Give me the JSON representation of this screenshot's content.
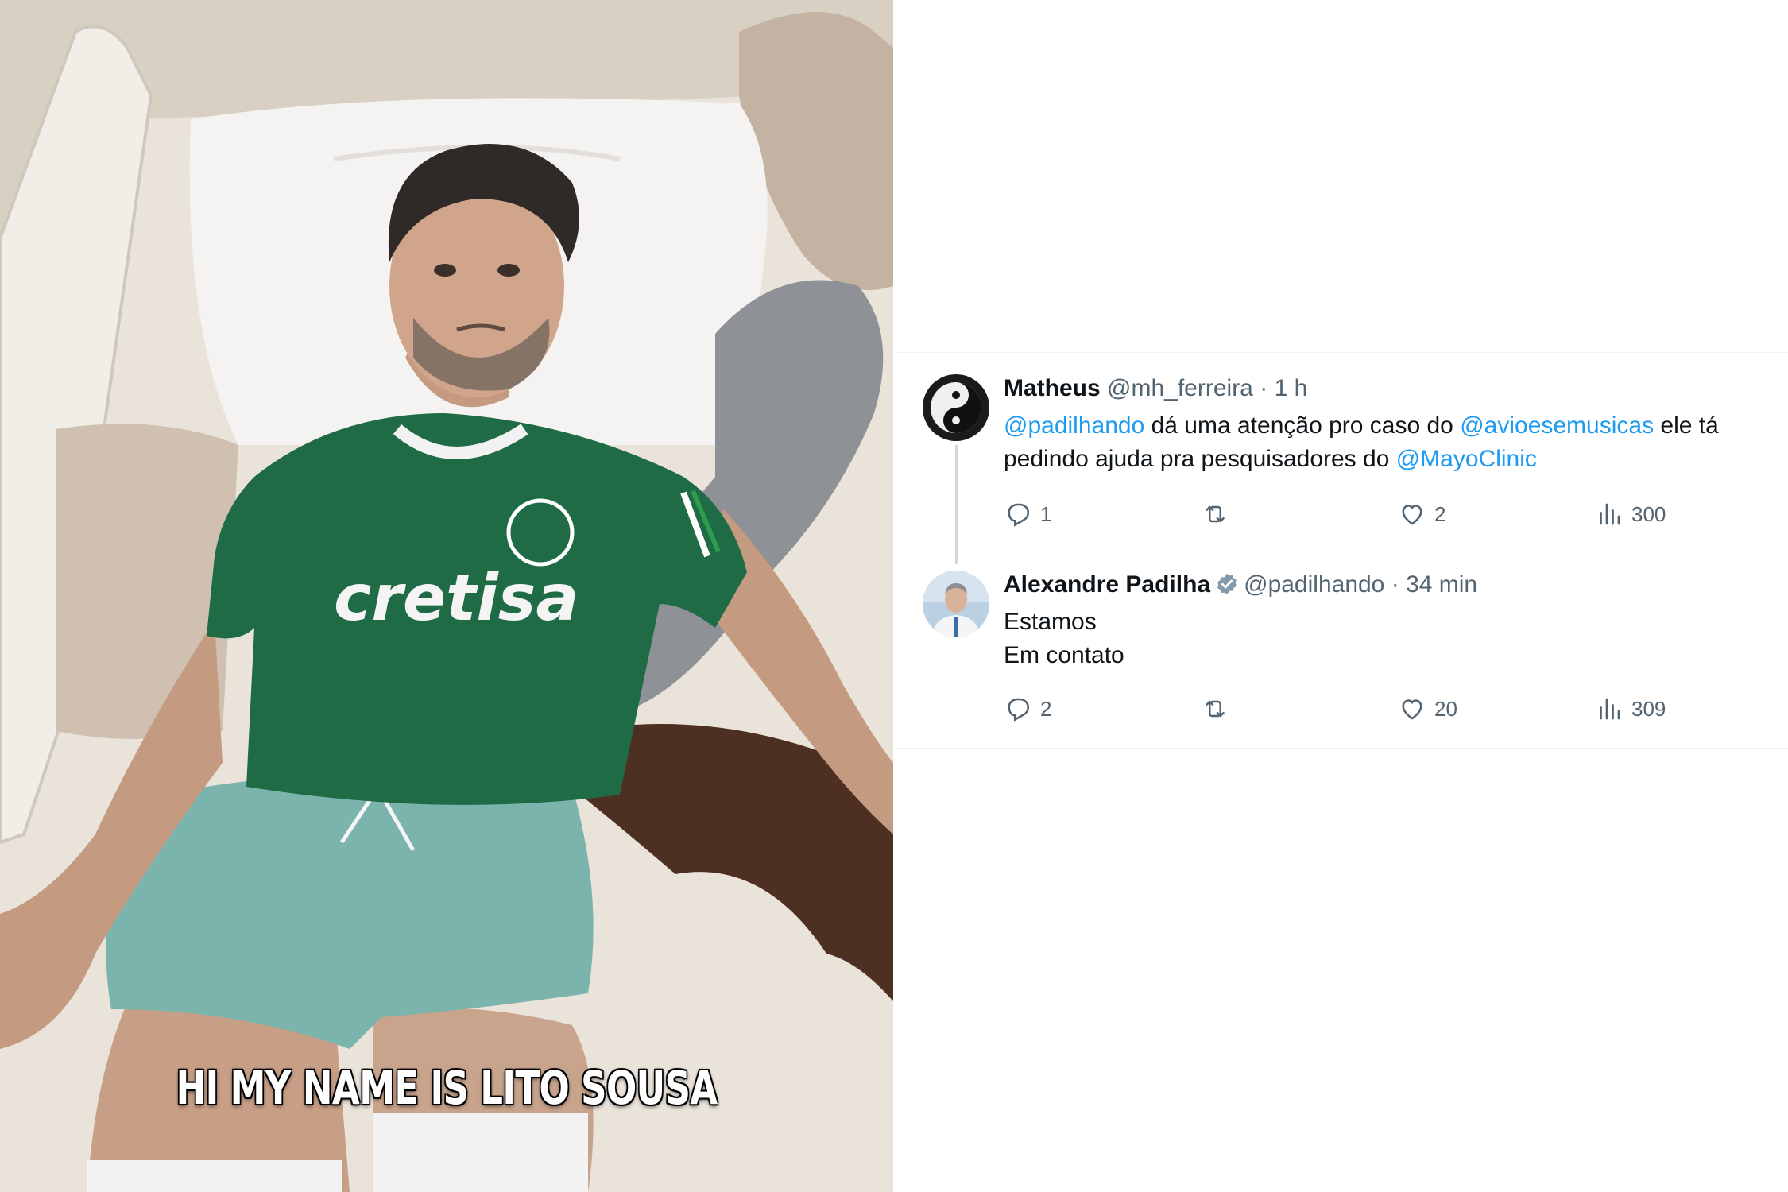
{
  "photo": {
    "caption": "HI MY NAME IS LITO SOUSA",
    "shirt_sponsor": "cretisa"
  },
  "tweets": [
    {
      "name": "Matheus",
      "handle": "@mh_ferreira",
      "separator": "·",
      "time": "1 h",
      "verified": false,
      "text": {
        "m1": "@padilhando",
        "t1": " dá uma atenção pro caso do ",
        "m2": "@avioesemusicas",
        "t2": " ele tá pedindo ajuda pra pesquisadores do ",
        "m3": "@MayoClinic"
      },
      "stats": {
        "replies": "1",
        "retweets": "",
        "likes": "2",
        "views": "300"
      }
    },
    {
      "name": "Alexandre Padilha",
      "handle": "@padilhando",
      "separator": "·",
      "time": "34 min",
      "verified": true,
      "text": {
        "line1": "Estamos",
        "line2": "Em contato"
      },
      "stats": {
        "replies": "2",
        "retweets": "",
        "likes": "20",
        "views": "309"
      }
    }
  ],
  "colors": {
    "link": "#1d9bf0",
    "muted": "#536471",
    "text": "#0f1419",
    "jersey": "#1e6b45"
  },
  "icons": [
    "reply-icon",
    "retweet-icon",
    "like-icon",
    "views-icon",
    "verified-badge-icon"
  ]
}
